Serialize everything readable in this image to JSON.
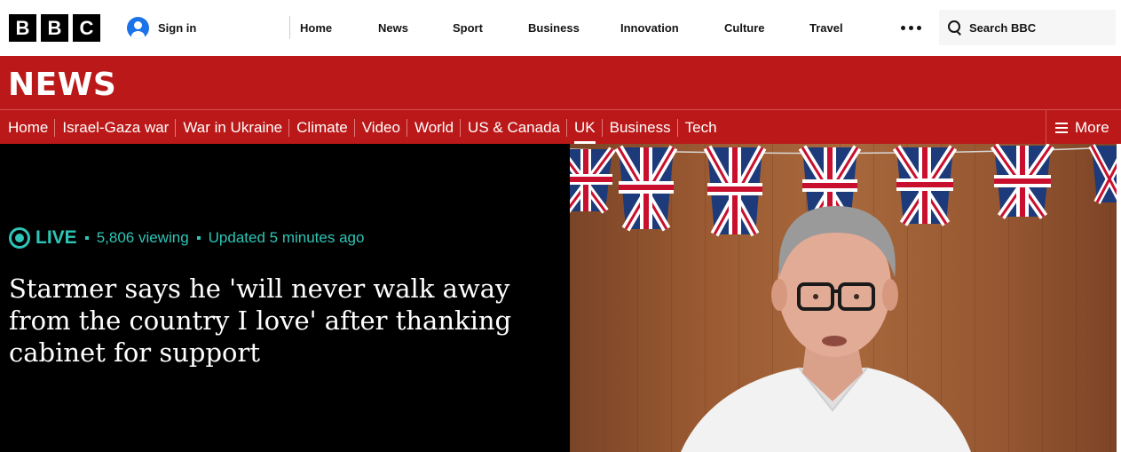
{
  "masthead": {
    "logo_letters": [
      "B",
      "B",
      "C"
    ],
    "sign_in": "Sign in",
    "nav": [
      "Home",
      "News",
      "Sport",
      "Business",
      "Innovation",
      "Culture",
      "Travel"
    ],
    "search_label": "Search BBC"
  },
  "news": {
    "title": "NEWS",
    "subnav": [
      "Home",
      "Israel-Gaza war",
      "War in Ukraine",
      "Climate",
      "Video",
      "World",
      "US & Canada",
      "UK",
      "Business",
      "Tech"
    ],
    "active_item": "UK",
    "more_label": "More"
  },
  "hero": {
    "live_label": "LIVE",
    "viewing": "5,806 viewing",
    "updated": "Updated 5 minutes ago",
    "headline": "Starmer says he 'will never walk away from the country I love' after thanking cabinet for support"
  },
  "colors": {
    "brand_red": "#bb1919",
    "live_teal": "#2ec4b6",
    "hero_bg": "#000000"
  }
}
